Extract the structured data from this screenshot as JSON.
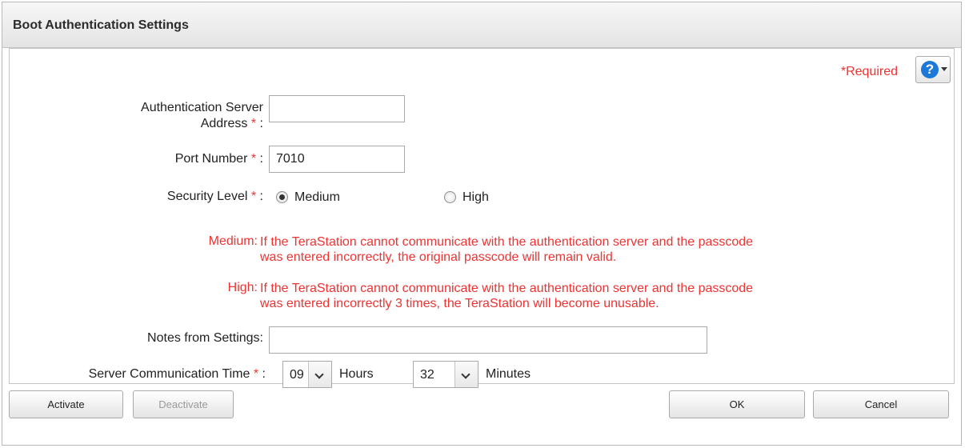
{
  "dialog": {
    "title": "Boot Authentication Settings"
  },
  "header": {
    "required_note": "*Required",
    "help_icon": "question-icon"
  },
  "form": {
    "server_address": {
      "label": "Authentication Server",
      "label2": "Address",
      "star": "*",
      "colon": ":",
      "value": ""
    },
    "port_number": {
      "label": "Port Number",
      "star": "*",
      "colon": ":",
      "value": "7010"
    },
    "security_level": {
      "label": "Security Level",
      "star": "*",
      "colon": ":",
      "options": [
        "Medium",
        "High"
      ],
      "selected": "Medium"
    },
    "descriptions": {
      "medium_key": "Medium:",
      "medium_line1": "If the TeraStation cannot communicate with the authentication server and the passcode",
      "medium_line2": "was entered incorrectly, the original passcode will remain valid.",
      "high_key": "High:",
      "high_line1": "If the TeraStation cannot communicate with the authentication server and the passcode",
      "high_line2": "was entered incorrectly 3 times, the TeraStation will become unusable."
    },
    "notes": {
      "label": "Notes from Settings:",
      "value": ""
    },
    "comm_time": {
      "label": "Server Communication Time",
      "star": "*",
      "colon": ":",
      "hours_value": "09",
      "hours_unit": "Hours",
      "minutes_value": "32",
      "minutes_unit": "Minutes"
    }
  },
  "footer": {
    "activate": "Activate",
    "deactivate": "Deactivate",
    "ok": "OK",
    "cancel": "Cancel"
  },
  "colors": {
    "required_red": "#ee3333",
    "help_blue": "#1e78d7"
  }
}
